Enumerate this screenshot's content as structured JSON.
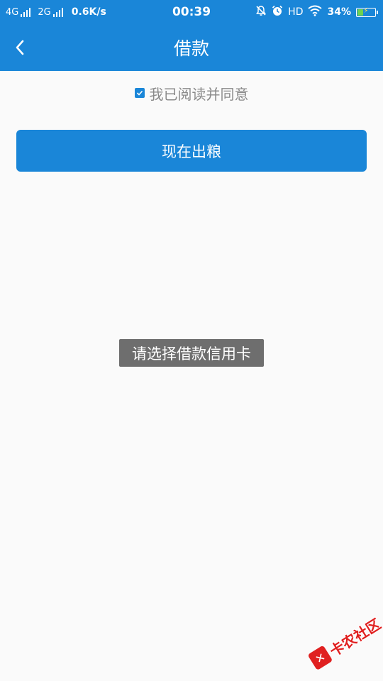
{
  "status_bar": {
    "network1": "4G",
    "network2": "2G",
    "speed": "0.6K/s",
    "time": "00:39",
    "hd": "HD",
    "battery_percent": "34%",
    "battery_level": 0.34,
    "icons": [
      "signal-bars-icon",
      "mute-icon",
      "alarm-icon",
      "wifi-icon",
      "battery-charging-icon"
    ]
  },
  "header": {
    "title": "借款",
    "back_icon": "chevron-left-icon"
  },
  "agreement": {
    "checked": true,
    "label": "我已阅读并同意"
  },
  "actions": {
    "primary_label": "现在出粮"
  },
  "toast": {
    "message": "请选择借款信用卡"
  },
  "watermark": {
    "text": "卡农社区"
  },
  "colors": {
    "primary": "#1a86d8",
    "background": "#fafafa",
    "toast": "#6e6e6e",
    "watermark": "#e02020"
  }
}
